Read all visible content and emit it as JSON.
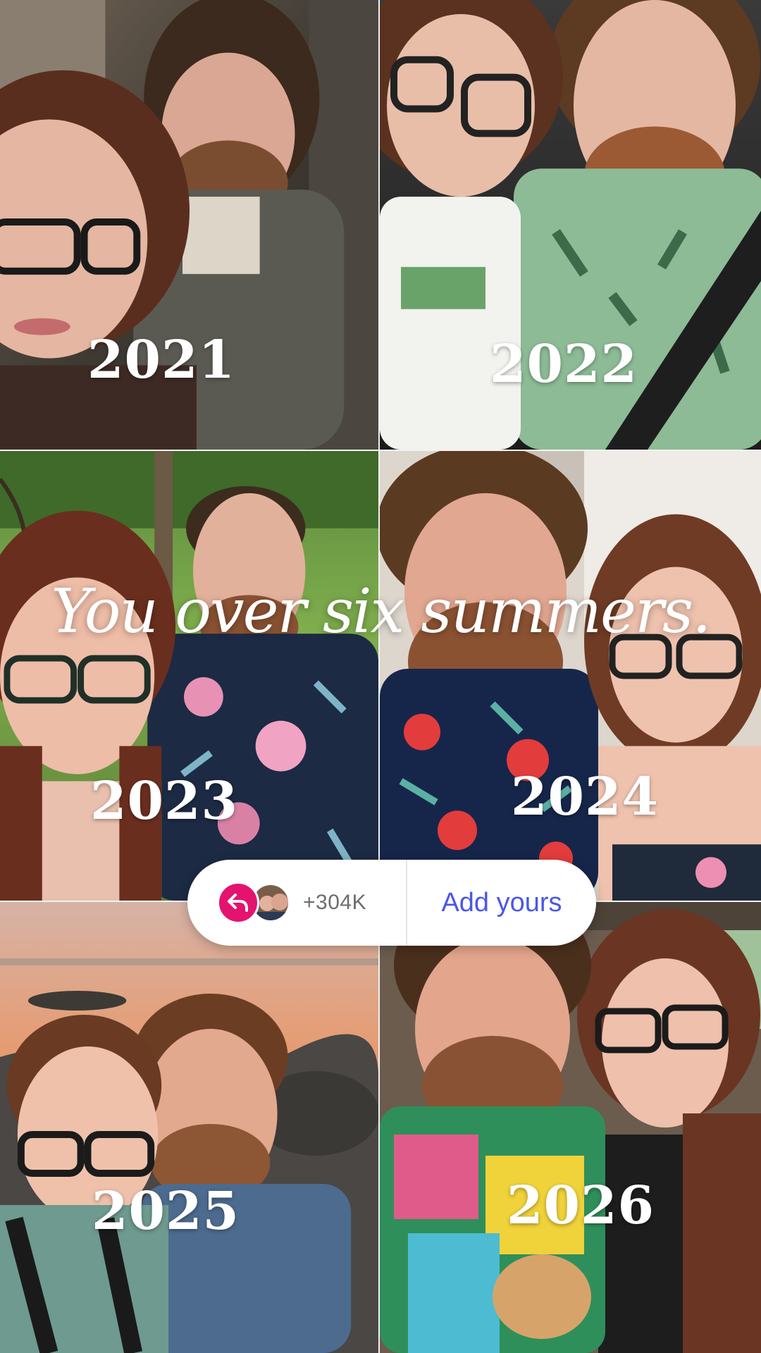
{
  "story": {
    "headline": "You over six summers."
  },
  "tiles": [
    {
      "year": "2021"
    },
    {
      "year": "2022"
    },
    {
      "year": "2023"
    },
    {
      "year": "2024"
    },
    {
      "year": "2025"
    },
    {
      "year": "2026"
    }
  ],
  "add_yours": {
    "reply_icon": "reply-arrow-icon",
    "participant_count": "+304K",
    "button_label": "Add yours",
    "accent_color": "#e4136f",
    "link_color": "#4b57e6"
  }
}
